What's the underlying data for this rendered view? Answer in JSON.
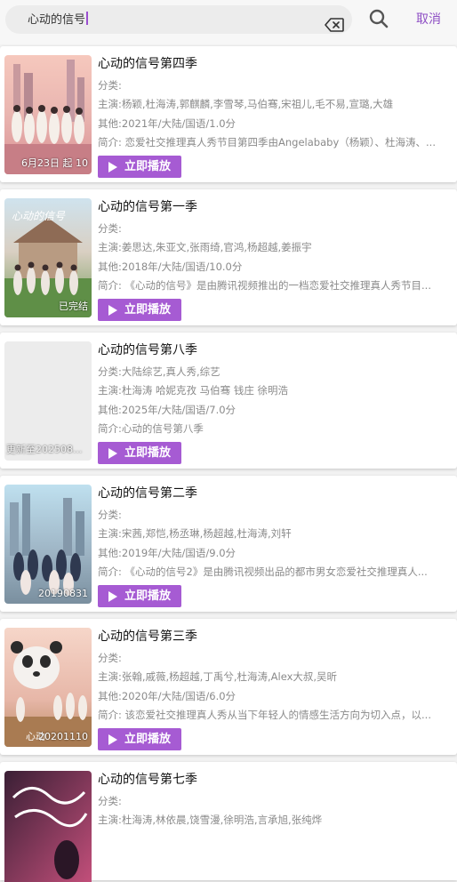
{
  "search": {
    "query": "心动的信号",
    "cancel_label": "取消"
  },
  "items": [
    {
      "title": "心动的信号第四季",
      "category": "分类:",
      "cast": "主演:杨颖,杜海涛,郭麒麟,李雪琴,马伯骞,宋祖儿,毛不易,宣璐,大雄",
      "other": "其他:2021年/大陆/国语/1.0分",
      "intro": "简介:        恋爱社交推理真人秀节目第四季由Angelababy（杨颖）、杜海涛、...",
      "play_label": "立即播放",
      "poster_caption": "6月23日 起 10"
    },
    {
      "title": "心动的信号第一季",
      "category": "分类:",
      "cast": "主演:姜思达,朱亚文,张雨绮,官鸿,杨超越,姜振宇",
      "other": "其他:2018年/大陆/国语/10.0分",
      "intro": "简介:        《心动的信号》是由腾讯视频推出的一档恋爱社交推理真人秀节目...",
      "play_label": "立即播放",
      "poster_caption": "已完结"
    },
    {
      "title": "心动的信号第八季",
      "category": "分类:大陆综艺,真人秀,综艺",
      "cast": "主演:杜海涛 哈妮克孜 马伯骞 钱庄 徐明浩",
      "other": "其他:2025年/大陆/国语/7.0分",
      "intro": "简介:心动的信号第八季",
      "play_label": "立即播放",
      "poster_caption": "更新至202508..."
    },
    {
      "title": "心动的信号第二季",
      "category": "分类:",
      "cast": "主演:宋茜,郑恺,杨丞琳,杨超越,杜海涛,刘轩",
      "other": "其他:2019年/大陆/国语/9.0分",
      "intro": "简介:        《心动的信号2》是由腾讯视频出品的都市男女恋爱社交推理真人...",
      "play_label": "立即播放",
      "poster_caption": "20190831"
    },
    {
      "title": "心动的信号第三季",
      "category": "分类:",
      "cast": "主演:张翰,戚薇,杨超越,丁禹兮,杜海涛,Alex大叔,吴昕",
      "other": "其他:2020年/大陆/国语/6.0分",
      "intro": "简介:        该恋爱社交推理真人秀从当下年轻人的情感生活方向为切入点，以...",
      "play_label": "立即播放",
      "poster_caption": "20201110"
    },
    {
      "title": "心动的信号第七季",
      "category": "分类:",
      "cast": "主演:杜海涛,林依晨,饶雪漫,徐明浩,言承旭,张纯烨",
      "other": "",
      "intro": "",
      "play_label": "",
      "poster_caption": ""
    }
  ]
}
